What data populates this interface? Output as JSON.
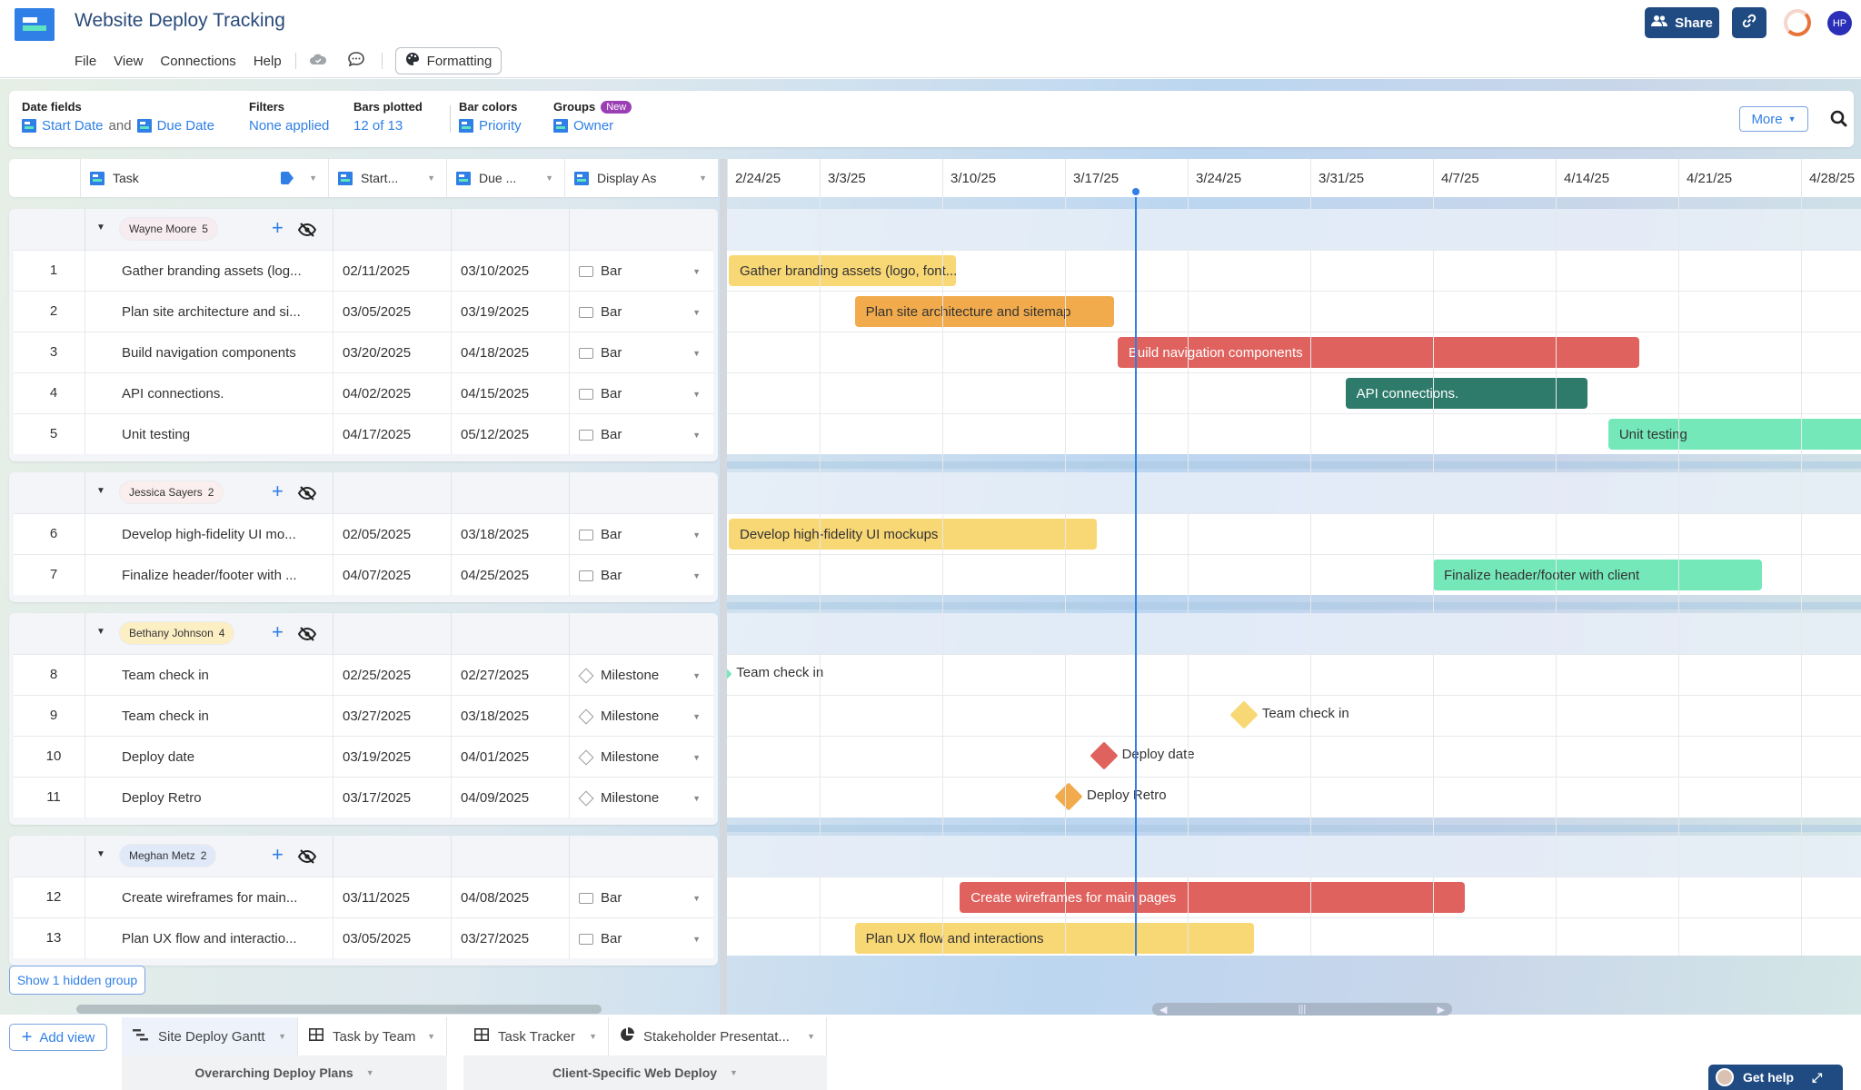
{
  "app": {
    "title": "Website Deploy Tracking",
    "menu": [
      "File",
      "View",
      "Connections",
      "Help"
    ],
    "formatting_label": "Formatting",
    "share_label": "Share",
    "avatar_initials": "HP"
  },
  "filterbar": {
    "date_fields_label": "Date fields",
    "start_field": "Start Date",
    "and_text": "and",
    "due_field": "Due Date",
    "filters_label": "Filters",
    "filters_value": "None applied",
    "bars_plotted_label": "Bars plotted",
    "bars_plotted_value": "12 of 13",
    "bar_colors_label": "Bar colors",
    "bar_colors_value": "Priority",
    "groups_label": "Groups",
    "groups_badge": "New",
    "groups_value": "Owner",
    "more_label": "More"
  },
  "columns": {
    "task": "Task",
    "start": "Start...",
    "due": "Due ...",
    "display": "Display As"
  },
  "timeline": {
    "ticks": [
      "2/24/25",
      "3/3/25",
      "3/10/25",
      "3/17/25",
      "3/24/25",
      "3/31/25",
      "4/7/25",
      "4/14/25",
      "4/21/25",
      "4/28/25"
    ],
    "today": "2025-03-21"
  },
  "groups": [
    {
      "owner": "Wayne Moore",
      "count": "5",
      "chip_color": "#f7ecf0",
      "tasks": [
        {
          "num": "1",
          "task": "Gather branding assets (log...",
          "bar_label": "Gather branding assets (logo, font...",
          "start": "02/11/2025",
          "due": "03/10/2025",
          "display": "Bar",
          "color": "#f8d775",
          "text_color": "#333"
        },
        {
          "num": "2",
          "task": "Plan site architecture and si...",
          "bar_label": "Plan site architecture and sitemap",
          "start": "03/05/2025",
          "due": "03/19/2025",
          "display": "Bar",
          "color": "#f1ab4c",
          "text_color": "#333"
        },
        {
          "num": "3",
          "task": "Build navigation components",
          "bar_label": "Build navigation components",
          "start": "03/20/2025",
          "due": "04/18/2025",
          "display": "Bar",
          "color": "#e0625e",
          "text_color": "#fff"
        },
        {
          "num": "4",
          "task": "API connections.",
          "bar_label": "API connections.",
          "start": "04/02/2025",
          "due": "04/15/2025",
          "display": "Bar",
          "color": "#2e7a6b",
          "text_color": "#fff"
        },
        {
          "num": "5",
          "task": "Unit testing",
          "bar_label": "Unit testing",
          "start": "04/17/2025",
          "due": "05/12/2025",
          "display": "Bar",
          "color": "#74e8b8",
          "text_color": "#333"
        }
      ]
    },
    {
      "owner": "Jessica Sayers",
      "count": "2",
      "chip_color": "#faeeee",
      "tasks": [
        {
          "num": "6",
          "task": "Develop high-fidelity UI mo...",
          "bar_label": "Develop high-fidelity UI mockups",
          "start": "02/05/2025",
          "due": "03/18/2025",
          "display": "Bar",
          "color": "#f8d775",
          "text_color": "#333"
        },
        {
          "num": "7",
          "task": "Finalize header/footer with ...",
          "bar_label": "Finalize header/footer with client",
          "start": "04/07/2025",
          "due": "04/25/2025",
          "display": "Bar",
          "color": "#74e8b8",
          "text_color": "#333"
        }
      ]
    },
    {
      "owner": "Bethany Johnson",
      "count": "4",
      "chip_color": "#fcefc4",
      "tasks": [
        {
          "num": "8",
          "task": "Team check in",
          "bar_label": "Team check in",
          "start": "02/25/2025",
          "due": "02/27/2025",
          "display": "Milestone",
          "color": "#74e8b8",
          "text_color": "#333"
        },
        {
          "num": "9",
          "task": "Team check in",
          "bar_label": "Team check in",
          "start": "03/27/2025",
          "due": "03/18/2025",
          "display": "Milestone",
          "color": "#f8d775",
          "text_color": "#333"
        },
        {
          "num": "10",
          "task": "Deploy date",
          "bar_label": "Deploy date",
          "start": "03/19/2025",
          "due": "04/01/2025",
          "display": "Milestone",
          "color": "#e0625e",
          "text_color": "#333"
        },
        {
          "num": "11",
          "task": "Deploy Retro",
          "bar_label": "Deploy Retro",
          "start": "03/17/2025",
          "due": "04/09/2025",
          "display": "Milestone",
          "color": "#f1ab4c",
          "text_color": "#333"
        }
      ]
    },
    {
      "owner": "Meghan Metz",
      "count": "2",
      "chip_color": "#dfe9f8",
      "tasks": [
        {
          "num": "12",
          "task": "Create wireframes for main...",
          "bar_label": "Create wireframes for main pages",
          "start": "03/11/2025",
          "due": "04/08/2025",
          "display": "Bar",
          "color": "#e0625e",
          "text_color": "#fff"
        },
        {
          "num": "13",
          "task": "Plan UX flow and interactio...",
          "bar_label": "Plan UX flow and interactions",
          "start": "03/05/2025",
          "due": "03/27/2025",
          "display": "Bar",
          "color": "#f8d775",
          "text_color": "#333"
        }
      ]
    }
  ],
  "hidden_group_label": "Show 1 hidden group",
  "bottom": {
    "add_view": "Add view",
    "tabs": [
      {
        "label": "Site Deploy Gantt",
        "icon": "gantt-icon",
        "active": true
      },
      {
        "label": "Task by Team",
        "icon": "grid-icon",
        "active": false
      },
      {
        "label": "Task Tracker",
        "icon": "grid-icon",
        "active": false
      },
      {
        "label": "Stakeholder Presentat...",
        "icon": "chart-pie-icon",
        "active": false
      }
    ],
    "view_groups": [
      "Overarching Deploy Plans",
      "Client-Specific Web Deploy"
    ],
    "get_help": "Get help"
  }
}
